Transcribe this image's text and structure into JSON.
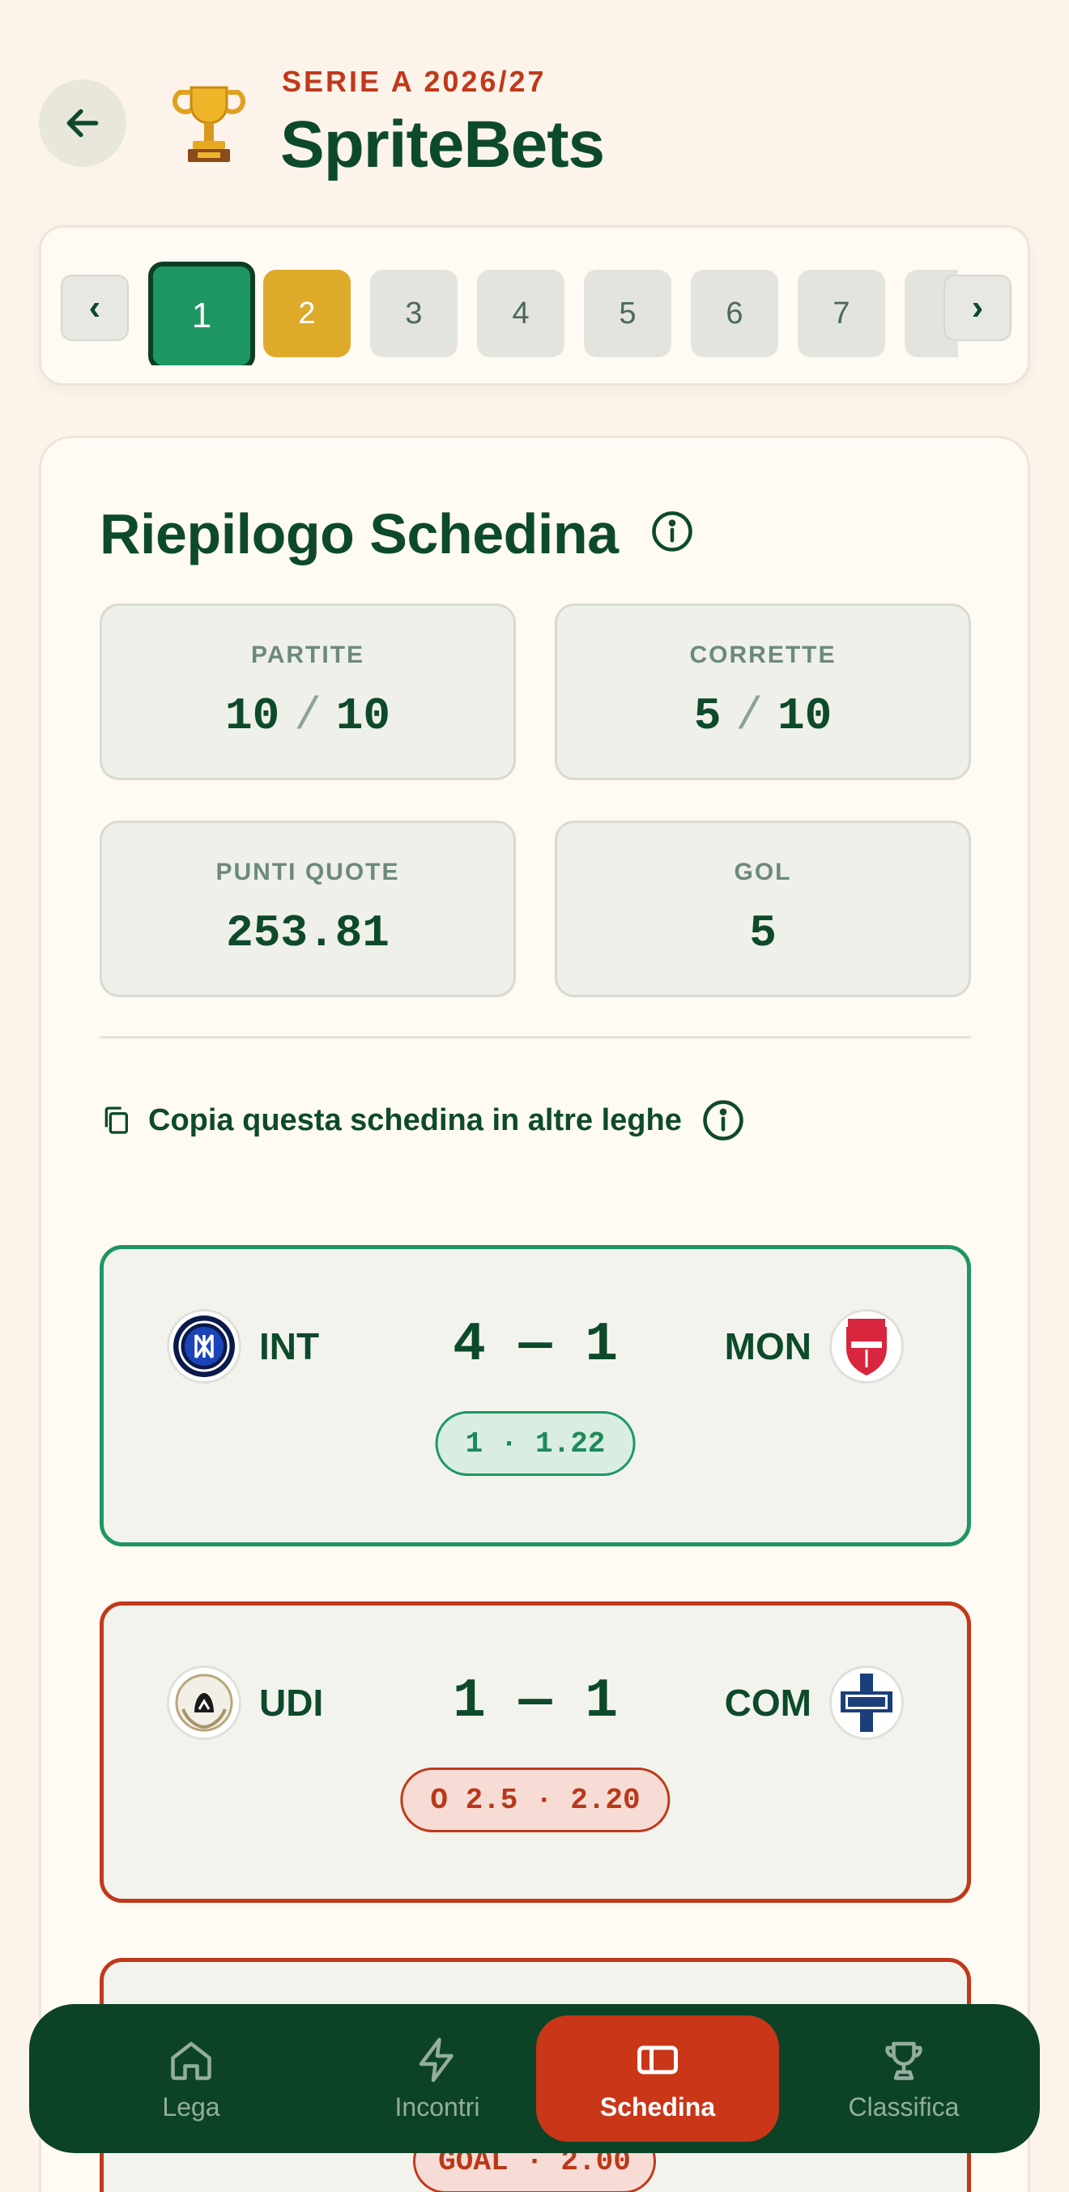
{
  "header": {
    "season": "SERIE A 2026/27",
    "title": "SpriteBets"
  },
  "rounds": {
    "items": [
      "1",
      "2",
      "3",
      "4",
      "5",
      "6",
      "7"
    ],
    "active": "1",
    "highlighted": "2",
    "prev_label": "‹",
    "next_label": "›"
  },
  "summary": {
    "title": "Riepilogo Schedina",
    "stats": {
      "matches": {
        "label": "PARTITE",
        "value": "10",
        "total": "10"
      },
      "correct": {
        "label": "CORRETTE",
        "value": "5",
        "total": "10"
      },
      "odds_points": {
        "label": "PUNTI QUOTE",
        "value": "253.81"
      },
      "goals": {
        "label": "GOL",
        "value": "5"
      }
    },
    "copy_label": "Copia questa schedina in altre leghe"
  },
  "matches": [
    {
      "home": "INT",
      "away": "MON",
      "score": "4 — 1",
      "pick": "1 · 1.22",
      "result": "won"
    },
    {
      "home": "UDI",
      "away": "COM",
      "score": "1 — 1",
      "pick": "O 2.5 · 2.20",
      "result": "lost"
    },
    {
      "pick": "GOAL · 2.00",
      "result": "lost"
    }
  ],
  "nav": {
    "items": [
      "Lega",
      "Incontri",
      "Schedina",
      "Classifica"
    ],
    "active": "Schedina"
  },
  "colors": {
    "background": "#fcf4ea",
    "primary_green": "#0d4a2c",
    "won_green": "#1e9663",
    "lost_red": "#c0391a",
    "gold": "#ddaa2a"
  }
}
